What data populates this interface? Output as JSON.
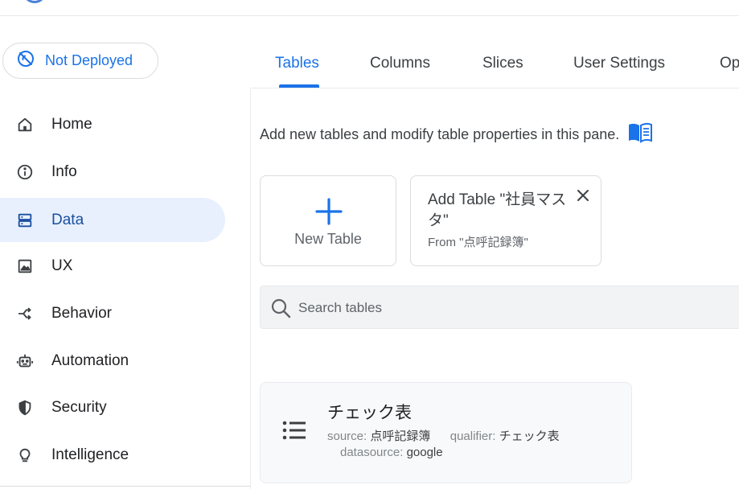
{
  "deploy": {
    "status_label": "Not Deployed"
  },
  "sidebar": {
    "items": [
      {
        "label": "Home",
        "icon": "home-icon"
      },
      {
        "label": "Info",
        "icon": "info-icon"
      },
      {
        "label": "Data",
        "icon": "data-icon",
        "active": true
      },
      {
        "label": "UX",
        "icon": "image-icon"
      },
      {
        "label": "Behavior",
        "icon": "shuffle-icon"
      },
      {
        "label": "Automation",
        "icon": "robot-icon"
      },
      {
        "label": "Security",
        "icon": "shield-icon"
      },
      {
        "label": "Intelligence",
        "icon": "lightbulb-icon"
      }
    ]
  },
  "tabs": {
    "items": [
      {
        "label": "Tables",
        "active": true
      },
      {
        "label": "Columns"
      },
      {
        "label": "Slices"
      },
      {
        "label": "User Settings"
      },
      {
        "label": "Op"
      }
    ]
  },
  "main": {
    "description": "Add new tables and modify table properties in this pane.",
    "new_table_label": "New Table",
    "suggestion": {
      "title": "Add Table \"社員マスタ\"",
      "subtitle": "From \"点呼記録簿\""
    },
    "search": {
      "placeholder": "Search tables",
      "value": ""
    },
    "tables": [
      {
        "name": "チェック表",
        "source_key": "source:",
        "source_value": "点呼記録簿",
        "qualifier_key": "qualifier:",
        "qualifier_value": "チェック表",
        "datasource_key": "datasource:",
        "datasource_value": "google"
      }
    ]
  },
  "colors": {
    "accent": "#1a73e8",
    "active_bg": "#e8f0fe",
    "text": "#202124",
    "muted": "#5f6368"
  }
}
